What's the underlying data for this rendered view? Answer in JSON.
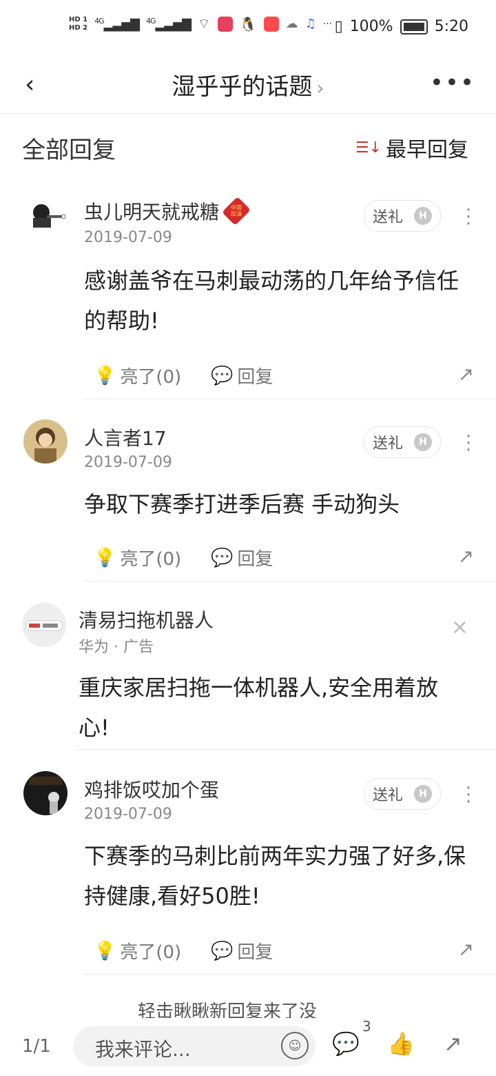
{
  "status_bar": {
    "hd1": "HD 1",
    "hd2": "HD 2",
    "signal1": "4G",
    "signal2": "4G",
    "more": "···",
    "battery_percent": "100%",
    "time": "5:20"
  },
  "nav": {
    "title": "湿乎乎的话题",
    "chevron": "›",
    "back": "‹",
    "more": "•••"
  },
  "header": {
    "all_replies": "全部回复",
    "sort_label": "最早回复"
  },
  "posts": [
    {
      "username": "虫儿明天就戒糖",
      "badge": "中国加油",
      "date": "2019-07-09",
      "content": "感谢盖爷在马刺最动荡的几年给予信任的帮助!",
      "gift_label": "送礼",
      "like_label": "亮了(0)",
      "reply_label": "回复"
    },
    {
      "username": "人言者17",
      "date": "2019-07-09",
      "content": "争取下赛季打进季后赛 手动狗头",
      "gift_label": "送礼",
      "like_label": "亮了(0)",
      "reply_label": "回复"
    },
    {
      "username": "鸡排饭哎加个蛋",
      "date": "2019-07-09",
      "content": "下赛季的马刺比前两年实力强了好多,保持健康,看好50胜!",
      "gift_label": "送礼",
      "like_label": "亮了(0)",
      "reply_label": "回复"
    }
  ],
  "ad": {
    "name": "清易扫拖机器人",
    "meta": "华为 · 广告",
    "content": "重庆家居扫拖一体机器人,安全用着放心!",
    "close": "×"
  },
  "peek_text": "轻击瞅瞅新回复来了没",
  "bottom_bar": {
    "page": "1/1",
    "comment_placeholder": "我来评论...",
    "comment_count": "3"
  },
  "colors": {
    "accent": "#c0392b",
    "divider": "#ececec"
  }
}
